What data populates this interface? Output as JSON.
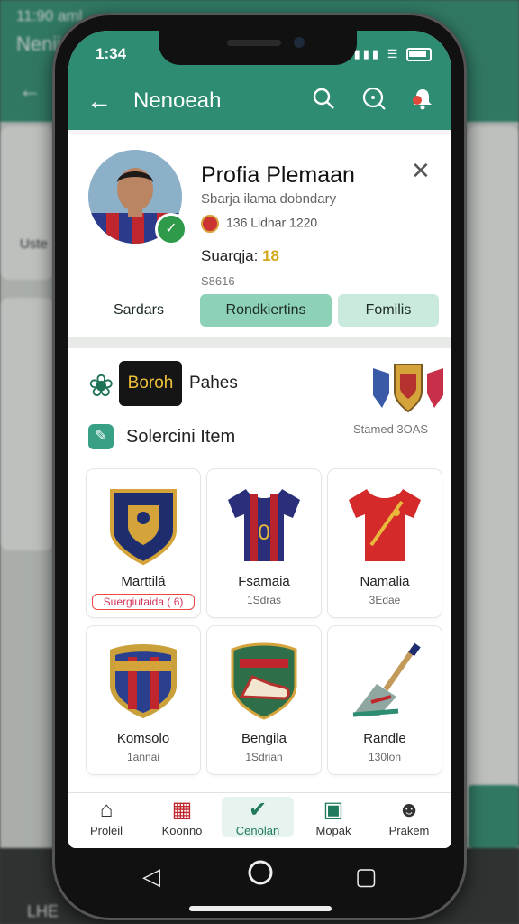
{
  "background": {
    "status_time": "11:90 aml",
    "title": "Nenii",
    "left_label": "Uste",
    "bottom_left": "LHE"
  },
  "status_bar": {
    "time": "1:34"
  },
  "app_bar": {
    "title": "Nenoeah"
  },
  "profile": {
    "name": "Profia Plemaan",
    "subtitle": "Sbarja ilama dobndary",
    "meta": "136 Lidnar 1220",
    "level_label": "Suarqja:",
    "level_value": "18",
    "code": "S8616"
  },
  "profile_tabs": [
    {
      "label": "Sardars"
    },
    {
      "label": "Rondkiertins"
    },
    {
      "label": "Fomilis"
    }
  ],
  "players_header": {
    "badge": "Boroh",
    "label": "Pahes"
  },
  "selection": {
    "title": "Solercini Item",
    "right_label": "Stamed 3OAS"
  },
  "items": [
    {
      "name": "Marttilá",
      "sub": "Suergiutaida ( 6)",
      "tag": true
    },
    {
      "name": "Fsamaia",
      "sub": "1Sdras"
    },
    {
      "name": "Namalia",
      "sub": "3Edae"
    },
    {
      "name": "Komsolo",
      "sub": "1annai"
    },
    {
      "name": "Bengila",
      "sub": "1Sdrian"
    },
    {
      "name": "Randle",
      "sub": "130lon"
    }
  ],
  "bottom_nav": [
    {
      "label": "Proleil",
      "icon": "home-icon"
    },
    {
      "label": "Koonno",
      "icon": "jersey-icon"
    },
    {
      "label": "Cenolan",
      "icon": "shield-check-icon",
      "active": true
    },
    {
      "label": "Mopak",
      "icon": "mask-icon"
    },
    {
      "label": "Prakem",
      "icon": "person-icon"
    }
  ],
  "colors": {
    "primary": "#2e8c72",
    "accent_light": "#8dd2b6",
    "gold": "#d4a91a"
  }
}
